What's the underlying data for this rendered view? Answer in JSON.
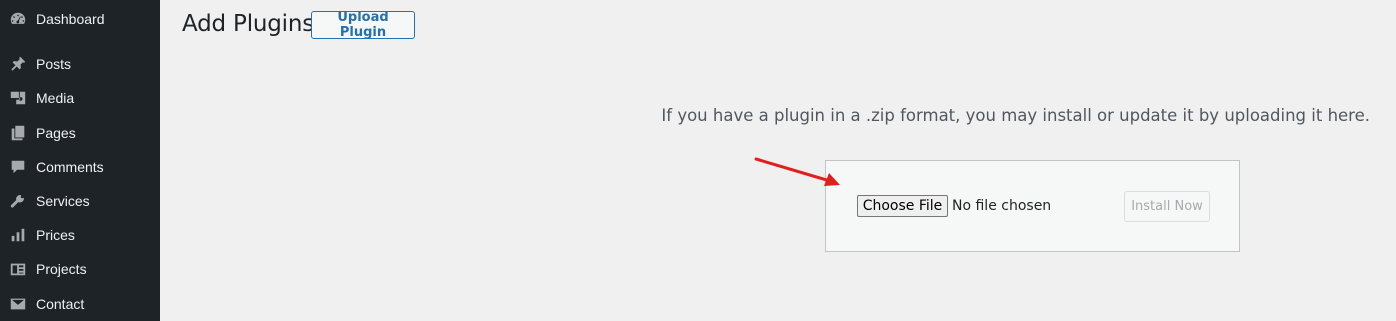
{
  "sidebar": {
    "items": [
      {
        "label": "Dashboard",
        "icon": "dashboard-icon"
      },
      {
        "label": "Posts",
        "icon": "pin-icon"
      },
      {
        "label": "Media",
        "icon": "media-icon"
      },
      {
        "label": "Pages",
        "icon": "pages-icon"
      },
      {
        "label": "Comments",
        "icon": "comments-icon"
      },
      {
        "label": "Services",
        "icon": "wrench-icon"
      },
      {
        "label": "Prices",
        "icon": "bar-chart-icon"
      },
      {
        "label": "Projects",
        "icon": "portfolio-icon"
      },
      {
        "label": "Contact",
        "icon": "envelope-icon"
      }
    ]
  },
  "header": {
    "title": "Add Plugins",
    "upload_button": "Upload Plugin"
  },
  "upload": {
    "help_text": "If you have a plugin in a .zip format, you may install or update it by uploading it here.",
    "choose_file_label": "Choose File",
    "file_status": "No file chosen",
    "install_button": "Install Now"
  },
  "colors": {
    "sidebar_bg": "#1d2327",
    "page_bg": "#f0f0f1",
    "accent": "#2271b1",
    "annotation_arrow": "#e0201c"
  }
}
